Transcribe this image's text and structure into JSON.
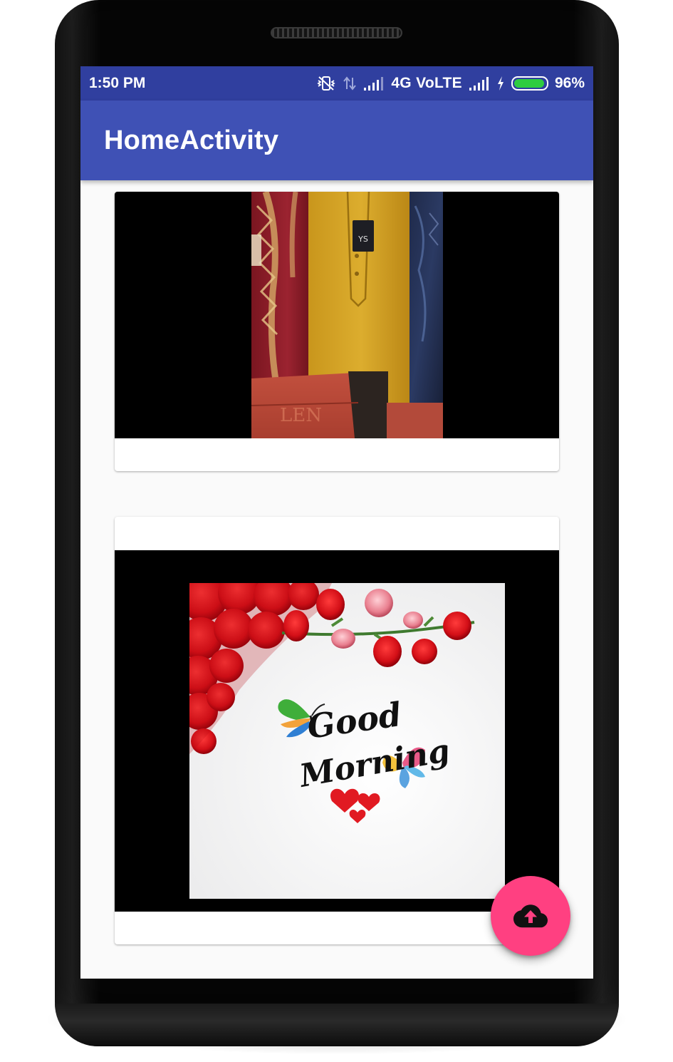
{
  "status_bar": {
    "time": "1:50 PM",
    "network_label": "4G VoLTE",
    "battery_percent": "96%",
    "battery_level": 0.96,
    "icons": [
      "vibrate-off-icon",
      "data-transfer-icon",
      "signal-icon",
      "signal-icon",
      "charging-bolt-icon",
      "battery-icon"
    ]
  },
  "app_bar": {
    "title": "HomeActivity"
  },
  "feed": {
    "cards": [
      {
        "image": "clothing-photo"
      },
      {
        "image": "good-morning-roses-photo",
        "image_text": [
          "Good",
          "Morning"
        ]
      }
    ]
  },
  "fab": {
    "icon": "cloud-upload-icon"
  },
  "colors": {
    "status_bar": "#303f9f",
    "app_bar": "#3f51b5",
    "fab": "#ff4081",
    "background": "#fafafa"
  }
}
